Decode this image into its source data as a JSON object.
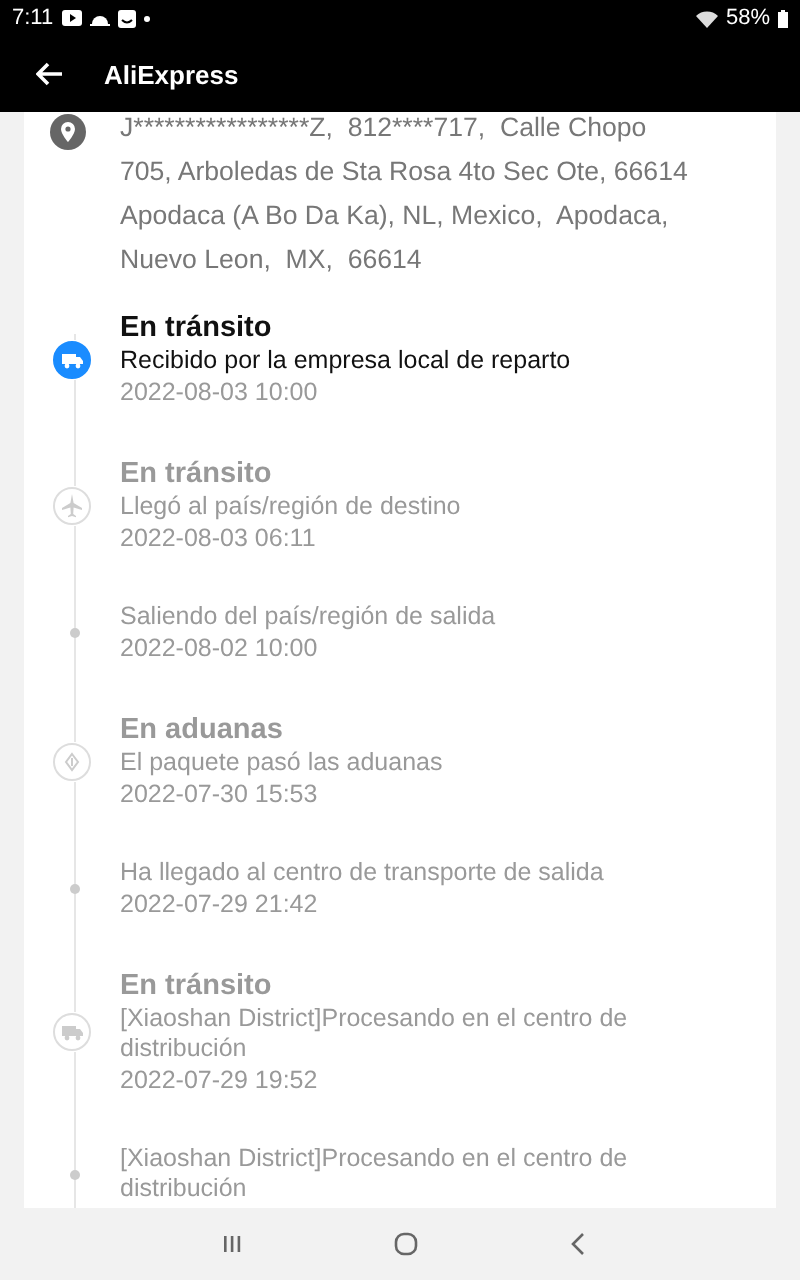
{
  "status_bar": {
    "time": "7:11",
    "battery": "58%"
  },
  "app_bar": {
    "title": "AliExpress"
  },
  "address": "J*****************Z,  812****717,  Calle Chopo 705, Arboledas de Sta Rosa 4to Sec Ote, 66614 Apodaca (A Bo Da Ka), NL, Mexico,  Apodaca,  Nuevo Leon,  MX,  66614",
  "events": [
    {
      "kind": "transit",
      "current": true,
      "title": "En tránsito",
      "description": "Recibido por la empresa local de reparto",
      "time": "2022-08-03 10:00"
    },
    {
      "kind": "arrival",
      "current": false,
      "title": "En tránsito",
      "description": "Llegó al país/región de destino",
      "time": "2022-08-03 06:11"
    },
    {
      "kind": "minor",
      "current": false,
      "description": "Saliendo del país/región de salida",
      "time": "2022-08-02 10:00"
    },
    {
      "kind": "customs",
      "current": false,
      "title": "En aduanas",
      "description": "El paquete pasó las aduanas",
      "time": "2022-07-30 15:53"
    },
    {
      "kind": "minor",
      "current": false,
      "description": "Ha llegado al centro de transporte de salida",
      "time": "2022-07-29 21:42"
    },
    {
      "kind": "transit",
      "current": false,
      "title": "En tránsito",
      "description": "[Xiaoshan District]Procesando en el centro de distribución",
      "time": "2022-07-29 19:52"
    },
    {
      "kind": "minor",
      "current": false,
      "description": "[Xiaoshan District]Procesando en el centro de distribución"
    }
  ]
}
